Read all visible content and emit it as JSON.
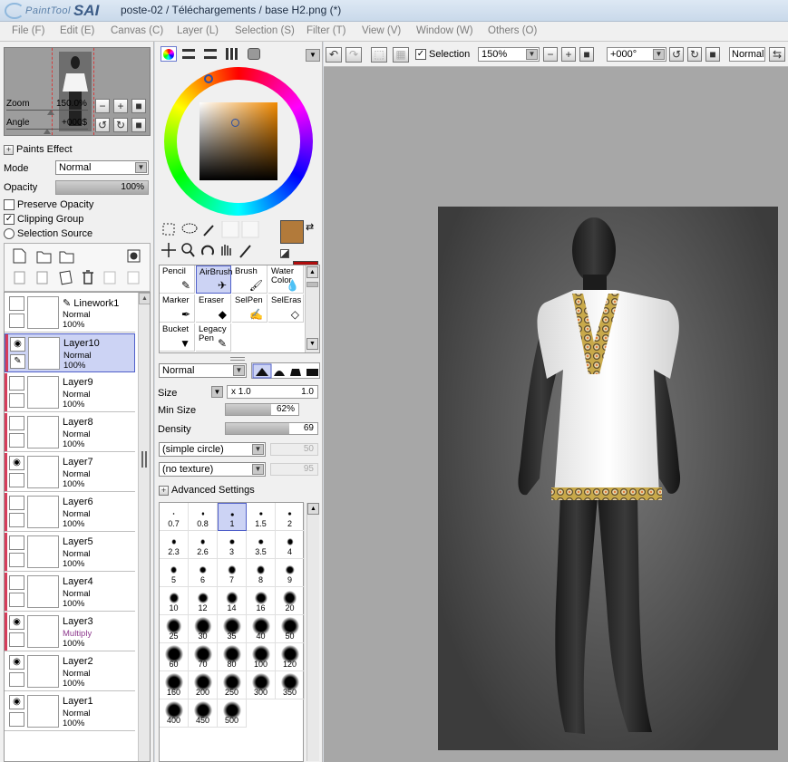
{
  "app": {
    "logo_small": "PaintTool",
    "logo_big": "SAI",
    "title": "poste-02 / Téléchargements / base H2.png (*)"
  },
  "menu": [
    {
      "label": "File (F)"
    },
    {
      "label": "Edit (E)"
    },
    {
      "label": "Canvas (C)"
    },
    {
      "label": "Layer (L)"
    },
    {
      "label": "Selection (S)"
    },
    {
      "label": "Filter (T)"
    },
    {
      "label": "View (V)"
    },
    {
      "label": "Window (W)"
    },
    {
      "label": "Others (O)"
    }
  ],
  "navigator": {
    "zoom_label": "Zoom",
    "zoom_value": "150.0%",
    "angle_label": "Angle",
    "angle_value": "+000$"
  },
  "layer_panel": {
    "paints_effect": "Paints Effect",
    "mode_label": "Mode",
    "mode_value": "Normal",
    "opacity_label": "Opacity",
    "opacity_value": "100%",
    "preserve_opacity": "Preserve Opacity",
    "clipping_group": "Clipping Group",
    "selection_source": "Selection Source"
  },
  "layers": [
    {
      "name": "Linework1",
      "mode": "Normal",
      "opacity": "100%",
      "visible": false,
      "selected": false,
      "clipped": false
    },
    {
      "name": "Layer10",
      "mode": "Normal",
      "opacity": "100%",
      "visible": true,
      "selected": true,
      "clipped": true
    },
    {
      "name": "Layer9",
      "mode": "Normal",
      "opacity": "100%",
      "visible": false,
      "selected": false,
      "clipped": true
    },
    {
      "name": "Layer8",
      "mode": "Normal",
      "opacity": "100%",
      "visible": false,
      "selected": false,
      "clipped": true
    },
    {
      "name": "Layer7",
      "mode": "Normal",
      "opacity": "100%",
      "visible": true,
      "selected": false,
      "clipped": true
    },
    {
      "name": "Layer6",
      "mode": "Normal",
      "opacity": "100%",
      "visible": false,
      "selected": false,
      "clipped": true
    },
    {
      "name": "Layer5",
      "mode": "Normal",
      "opacity": "100%",
      "visible": false,
      "selected": false,
      "clipped": true
    },
    {
      "name": "Layer4",
      "mode": "Normal",
      "opacity": "100%",
      "visible": false,
      "selected": false,
      "clipped": true
    },
    {
      "name": "Layer3",
      "mode": "Multiply",
      "opacity": "100%",
      "visible": true,
      "selected": false,
      "clipped": true
    },
    {
      "name": "Layer2",
      "mode": "Normal",
      "opacity": "100%",
      "visible": true,
      "selected": false,
      "clipped": false
    },
    {
      "name": "Layer1",
      "mode": "Normal",
      "opacity": "100%",
      "visible": true,
      "selected": false,
      "clipped": false
    }
  ],
  "colors": {
    "primary": "#b27a3a",
    "secondary": "#b00d0d",
    "accent": "#4f5fc9",
    "clip_bar": "#d63c5a",
    "multiply_text": "#8e3a8e"
  },
  "tools": [
    {
      "label": "Pencil",
      "icon": "pencil-icon"
    },
    {
      "label": "AirBrush",
      "icon": "airbrush-icon"
    },
    {
      "label": "Brush",
      "icon": "brush-icon"
    },
    {
      "label": "Water Color",
      "icon": "watercolor-icon"
    },
    {
      "label": "Marker",
      "icon": "marker-icon"
    },
    {
      "label": "Eraser",
      "icon": "eraser-icon"
    },
    {
      "label": "SelPen",
      "icon": "selpen-icon"
    },
    {
      "label": "SelEras",
      "icon": "seleras-icon"
    },
    {
      "label": "Bucket",
      "icon": "bucket-icon"
    },
    {
      "label": "Legacy Pen",
      "icon": "legacy-pen-icon"
    }
  ],
  "tool_settings": {
    "blend_mode": "Normal",
    "size_label": "Size",
    "size_multiplier": "x 1.0",
    "size_value": "1.0",
    "min_size_label": "Min Size",
    "min_size_value": "62%",
    "min_size_fraction": 0.62,
    "density_label": "Density",
    "density_value": "69",
    "density_fraction": 0.69,
    "shape": "(simple circle)",
    "shape_value": "50",
    "texture": "(no texture)",
    "texture_value": "95",
    "advanced": "Advanced Settings"
  },
  "brush_sizes": [
    "0.7",
    "0.8",
    "1",
    "1.5",
    "2",
    "2.3",
    "2.6",
    "3",
    "3.5",
    "4",
    "5",
    "6",
    "7",
    "8",
    "9",
    "10",
    "12",
    "14",
    "16",
    "20",
    "25",
    "30",
    "35",
    "40",
    "50",
    "60",
    "70",
    "80",
    "100",
    "120",
    "160",
    "200",
    "250",
    "300",
    "350",
    "400",
    "450",
    "500"
  ],
  "canvas_toolbar": {
    "selection_label": "Selection",
    "zoom": "150%",
    "angle": "+000°",
    "mode": "Normal"
  }
}
